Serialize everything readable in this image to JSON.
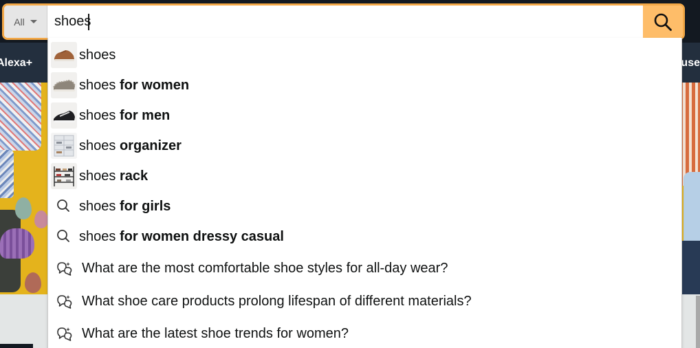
{
  "search": {
    "department": "All",
    "query": "shoes"
  },
  "nav": {
    "left_item": "Alexa+",
    "right_item_partial": "use"
  },
  "suggestions": [
    {
      "prefix": "shoes",
      "suffix": "",
      "icon": "brown-sneaker-thumbnail"
    },
    {
      "prefix": "shoes",
      "suffix": "for women",
      "icon": "gray-slip-on-thumbnail"
    },
    {
      "prefix": "shoes",
      "suffix": "for men",
      "icon": "black-sneaker-thumbnail"
    },
    {
      "prefix": "shoes",
      "suffix": "organizer",
      "icon": "shoe-organizer-thumbnail"
    },
    {
      "prefix": "shoes",
      "suffix": "rack",
      "icon": "shoe-rack-thumbnail"
    },
    {
      "prefix": "shoes",
      "suffix": "for girls",
      "icon": "search-icon"
    },
    {
      "prefix": "shoes",
      "suffix": "for women dressy casual",
      "icon": "search-icon"
    }
  ],
  "questions": [
    {
      "text": "What are the most comfortable shoe styles for all-day wear?",
      "icon": "ai-chat-icon"
    },
    {
      "text": "What shoe care products prolong lifespan of different materials?",
      "icon": "ai-chat-icon"
    },
    {
      "text": "What are the latest shoe trends for women?",
      "icon": "ai-chat-icon"
    }
  ],
  "colors": {
    "header_bg": "#131921",
    "nav_bg": "#232f3e",
    "search_focus_border": "#f3a847",
    "search_button": "#febd69",
    "hero_bg": "#e4b31c"
  }
}
